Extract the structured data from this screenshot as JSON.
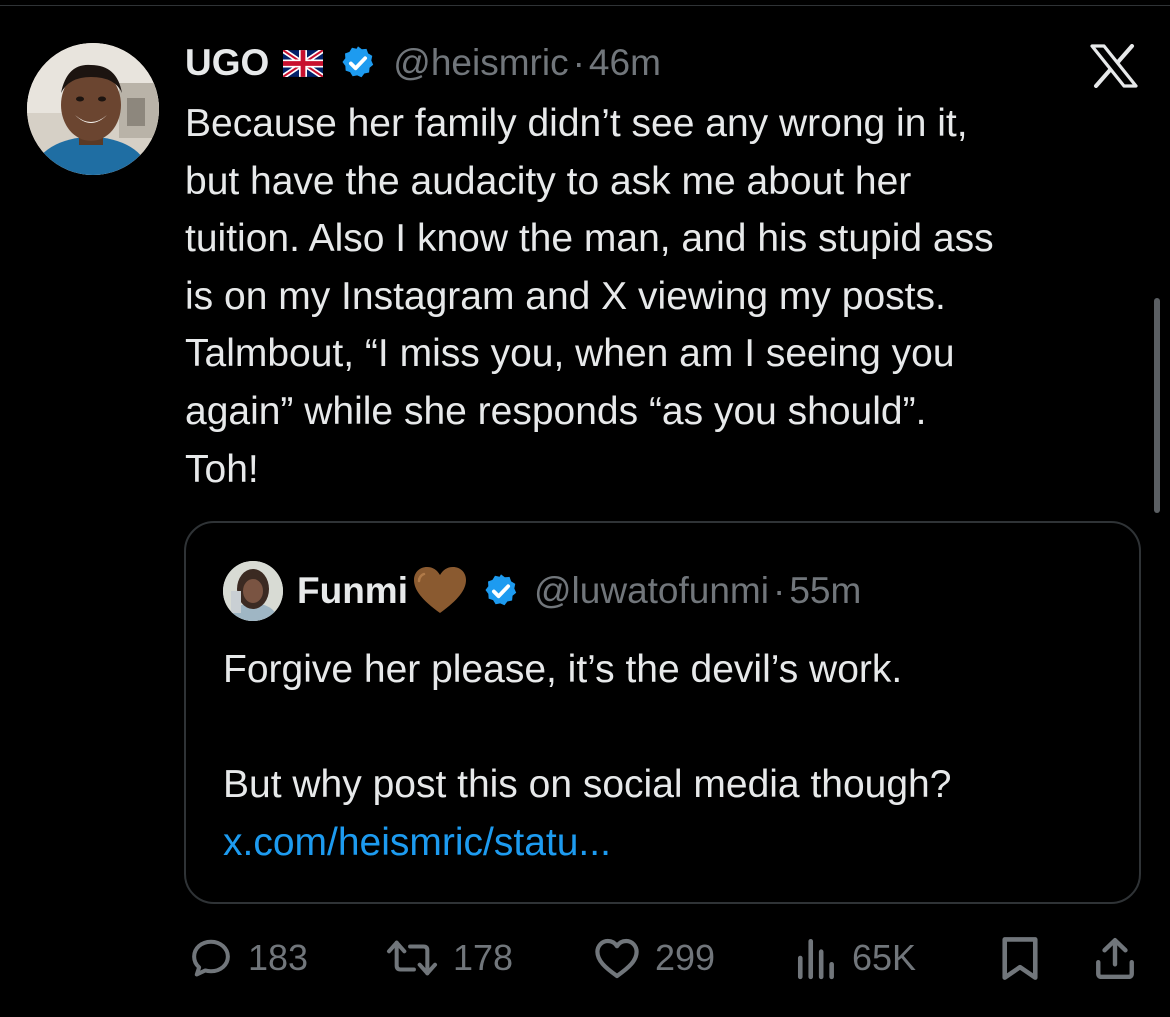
{
  "tweet": {
    "author": {
      "display_name": "UGO",
      "flag_icon": "uk-flag-icon",
      "verified_icon": "verified-badge-icon",
      "handle": "@heismric",
      "separator": "·",
      "time": "46m"
    },
    "text_lines": [
      "Because her family didn’t see any wrong in it,",
      "but have the audacity to ask me about her",
      "tuition. Also I know the man, and his stupid ass",
      "is on my Instagram and X viewing my posts.",
      "Talmbout, “I miss you, when am I seeing you",
      "again” while she responds “as you should”.",
      "Toh!"
    ],
    "platform_icon": "x-logo-icon"
  },
  "quoted": {
    "author": {
      "display_name": "Funmi",
      "emoji": "brown-heart-emoji",
      "verified_icon": "verified-badge-icon",
      "handle": "@luwatofunmi",
      "separator": "·",
      "time": "55m"
    },
    "text_line_1": "Forgive her please, it’s the devil’s work.",
    "text_line_2": "But why post this on social media though?",
    "link": "x.com/heismric/statu..."
  },
  "actions": {
    "replies": "183",
    "reposts": "178",
    "likes": "299",
    "views": "65K",
    "bookmark_icon": "bookmark-icon",
    "share_icon": "share-icon"
  },
  "colors": {
    "background": "#000000",
    "text": "#e7e9ea",
    "secondary": "#71767b",
    "link": "#1d9bf0",
    "verified": "#1d9bf0",
    "border": "#2f3336"
  }
}
